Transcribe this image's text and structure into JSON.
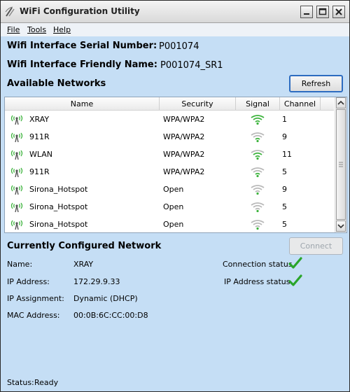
{
  "window": {
    "title": "WiFi Configuration Utility"
  },
  "menu": {
    "file": "File",
    "tools": "Tools",
    "help": "Help"
  },
  "interface": {
    "serial_label": "Wifi Interface Serial Number:",
    "serial_value": "P001074",
    "friendly_label": "Wifi Interface Friendly Name:",
    "friendly_value": "P001074_SR1"
  },
  "available": {
    "title": "Available Networks",
    "refresh_label": "Refresh",
    "columns": {
      "name": "Name",
      "security": "Security",
      "signal": "Signal",
      "channel": "Channel"
    },
    "rows": [
      {
        "name": "XRAY",
        "security": "WPA/WPA2",
        "channel": "1",
        "signal_level": 4
      },
      {
        "name": "911R",
        "security": "WPA/WPA2",
        "channel": "9",
        "signal_level": 2
      },
      {
        "name": "WLAN",
        "security": "WPA/WPA2",
        "channel": "11",
        "signal_level": 3
      },
      {
        "name": "911R",
        "security": "WPA/WPA2",
        "channel": "5",
        "signal_level": 2
      },
      {
        "name": "Sirona_Hotspot",
        "security": "Open",
        "channel": "9",
        "signal_level": 1
      },
      {
        "name": "Sirona_Hotspot",
        "security": "Open",
        "channel": "5",
        "signal_level": 1
      },
      {
        "name": "Sirona_Hotspot",
        "security": "Open",
        "channel": "5",
        "signal_level": 1
      }
    ]
  },
  "configured": {
    "title": "Currently Configured Network",
    "connect_label": "Connect",
    "name_label": "Name:",
    "name_value": "XRAY",
    "ip_label": "IP Address:",
    "ip_value": "172.29.9.33",
    "assign_label": "IP Assignment:",
    "assign_value": "Dynamic (DHCP)",
    "mac_label": "MAC Address:",
    "mac_value": "00:0B:6C:CC:00:D8",
    "conn_status_label": "Connection status",
    "ip_status_label": "IP Address status"
  },
  "status": {
    "label": "Status:",
    "value": "Ready"
  },
  "colors": {
    "signal_on": "#3cb33c",
    "signal_off": "#b9b9b9",
    "check": "#2aa52a",
    "window_bg": "#c5def5"
  }
}
